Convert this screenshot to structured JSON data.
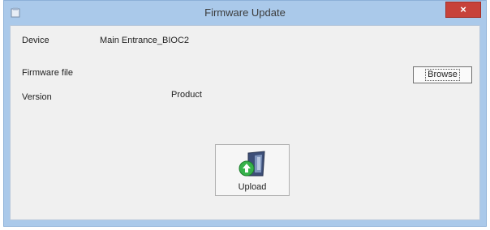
{
  "window": {
    "title": "Firmware Update",
    "close_glyph": "×"
  },
  "form": {
    "device_label": "Device",
    "device_value": "Main Entrance_BIOC2",
    "firmware_label": "Firmware file",
    "browse_label": "Browse",
    "version_label": "Version",
    "product_label": "Product"
  },
  "upload": {
    "label": "Upload",
    "icon": "upload-icon"
  }
}
